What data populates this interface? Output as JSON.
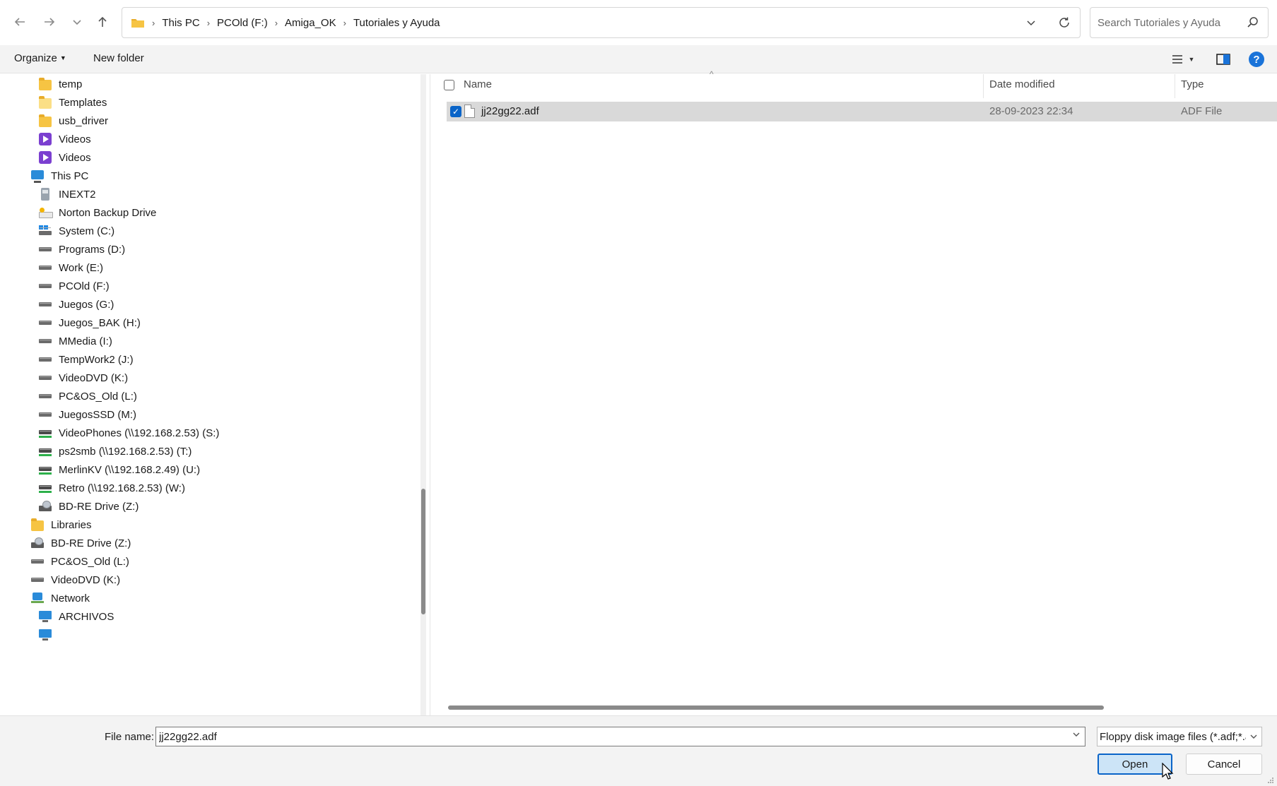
{
  "navigation": {
    "back_icon": "arrow-left-icon",
    "forward_icon": "arrow-right-icon",
    "recent_icon": "chevron-down-icon",
    "up_icon": "arrow-up-icon"
  },
  "address_bar": {
    "breadcrumbs": [
      "This PC",
      "PCOld (F:)",
      "Amiga_OK",
      "Tutoriales y Ayuda"
    ]
  },
  "search": {
    "placeholder": "Search Tutoriales y Ayuda"
  },
  "toolbar": {
    "organize_label": "Organize",
    "new_folder_label": "New folder",
    "help_label": "?"
  },
  "sidebar": {
    "items": [
      {
        "label": "temp",
        "icon": "folder-icon"
      },
      {
        "label": "Templates",
        "icon": "folder-icon"
      },
      {
        "label": "usb_driver",
        "icon": "folder-icon"
      },
      {
        "label": "Videos",
        "icon": "videos-icon"
      },
      {
        "label": "Videos",
        "icon": "videos-icon"
      },
      {
        "label": "This PC",
        "icon": "computer-icon"
      },
      {
        "label": "INEXT2",
        "icon": "device-icon"
      },
      {
        "label": "Norton Backup Drive",
        "icon": "backup-drive-icon"
      },
      {
        "label": "System (C:)",
        "icon": "system-drive-icon"
      },
      {
        "label": "Programs (D:)",
        "icon": "drive-icon"
      },
      {
        "label": "Work (E:)",
        "icon": "drive-icon"
      },
      {
        "label": "PCOld (F:)",
        "icon": "drive-icon"
      },
      {
        "label": "Juegos (G:)",
        "icon": "drive-icon"
      },
      {
        "label": "Juegos_BAK (H:)",
        "icon": "drive-icon"
      },
      {
        "label": "MMedia (I:)",
        "icon": "drive-icon"
      },
      {
        "label": "TempWork2 (J:)",
        "icon": "drive-icon"
      },
      {
        "label": "VideoDVD (K:)",
        "icon": "drive-icon"
      },
      {
        "label": "PC&OS_Old (L:)",
        "icon": "drive-icon"
      },
      {
        "label": "JuegosSSD (M:)",
        "icon": "drive-icon"
      },
      {
        "label": "VideoPhones (\\\\192.168.2.53) (S:)",
        "icon": "network-drive-icon"
      },
      {
        "label": "ps2smb (\\\\192.168.2.53) (T:)",
        "icon": "network-drive-icon"
      },
      {
        "label": "MerlinKV (\\\\192.168.2.49) (U:)",
        "icon": "network-drive-icon"
      },
      {
        "label": "Retro (\\\\192.168.2.53) (W:)",
        "icon": "network-drive-icon"
      },
      {
        "label": "BD-RE Drive (Z:)",
        "icon": "optical-drive-icon"
      },
      {
        "label": "Libraries",
        "icon": "folder-icon"
      },
      {
        "label": "BD-RE Drive (Z:)",
        "icon": "optical-drive-icon"
      },
      {
        "label": "PC&OS_Old (L:)",
        "icon": "drive-icon"
      },
      {
        "label": "VideoDVD (K:)",
        "icon": "drive-icon"
      },
      {
        "label": "Network",
        "icon": "network-icon"
      },
      {
        "label": "ARCHIVOS",
        "icon": "monitor-icon"
      }
    ]
  },
  "file_list": {
    "columns": [
      "Name",
      "Date modified",
      "Type"
    ],
    "rows": [
      {
        "name": "jj22gg22.adf",
        "date_modified": "28-09-2023 22:34",
        "type": "ADF File",
        "selected": true
      }
    ]
  },
  "footer": {
    "file_name_label": "File name:",
    "file_name_value": "jj22gg22.adf",
    "file_type_filter": "Floppy disk image files (*.adf;*.adz)",
    "open_label": "Open",
    "cancel_label": "Cancel"
  },
  "colors": {
    "accent": "#0a64c8",
    "selection": "#d9d9d9",
    "open_button_bg": "#cce4f7"
  }
}
